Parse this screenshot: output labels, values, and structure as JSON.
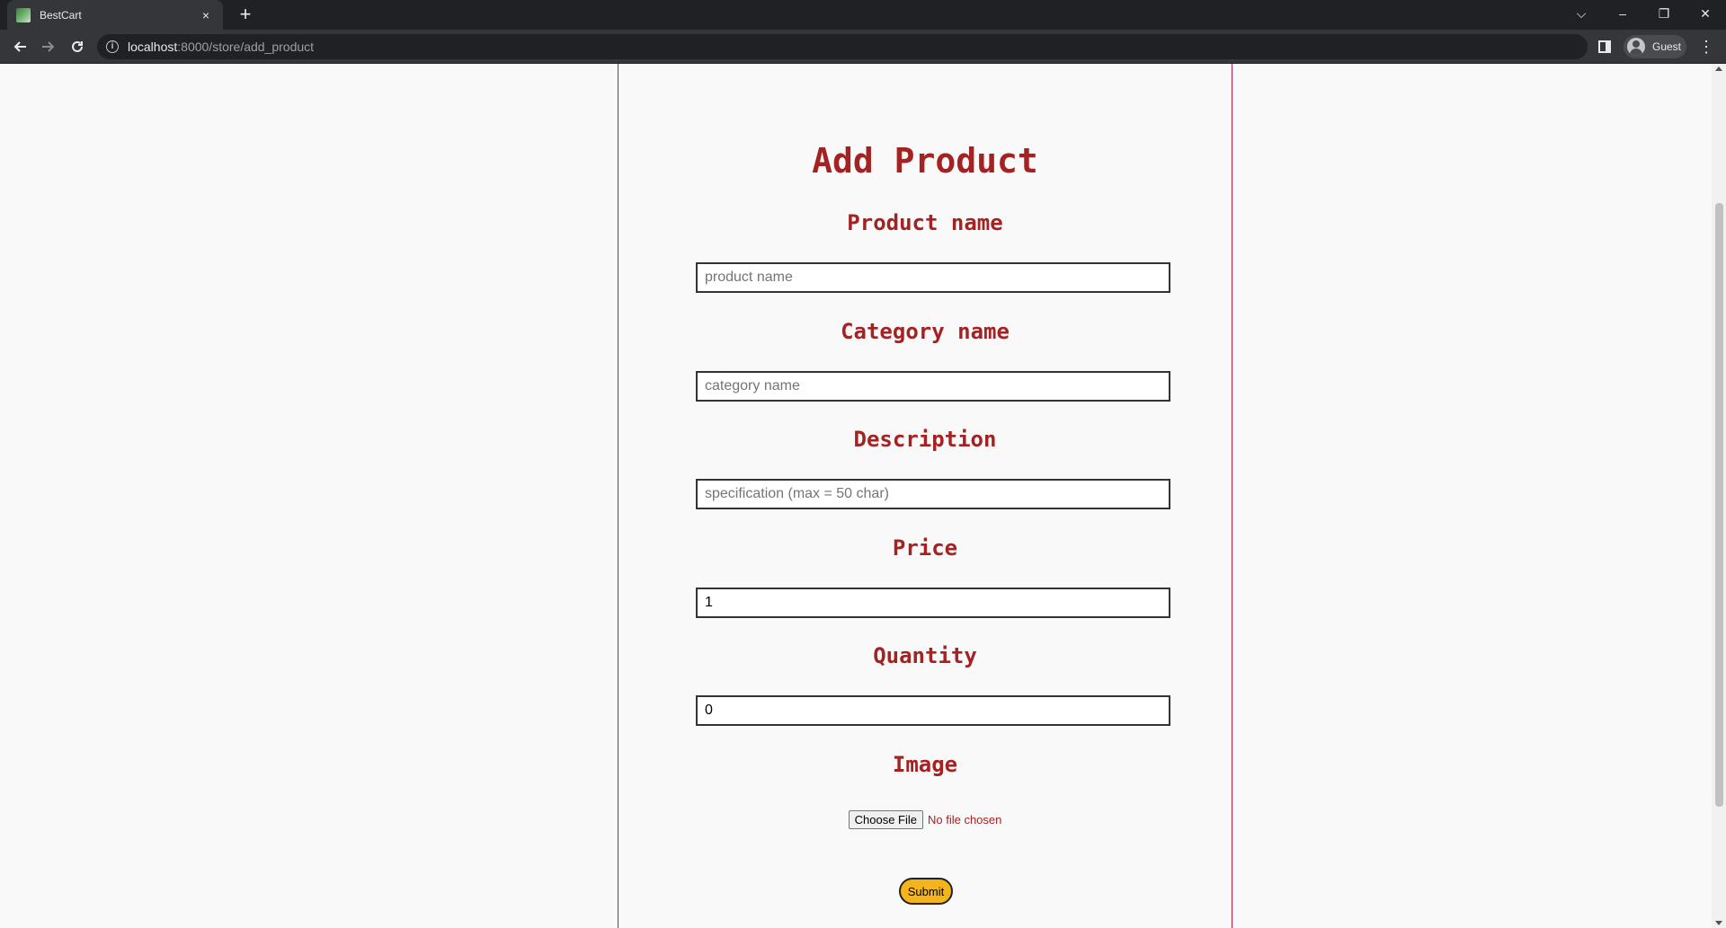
{
  "browser": {
    "tab_title": "BestCart",
    "tab_close": "×",
    "new_tab": "+",
    "url_host": "localhost",
    "url_path": ":8000/store/add_product",
    "profile_label": "Guest",
    "window_controls": {
      "dropdown": "⌵",
      "minimize": "–",
      "restore": "❐",
      "close": "✕"
    }
  },
  "page": {
    "title": "Add Product",
    "fields": {
      "product_name": {
        "label": "Product name",
        "placeholder": "product name",
        "value": ""
      },
      "category_name": {
        "label": "Category name",
        "placeholder": "category name",
        "value": ""
      },
      "description": {
        "label": "Description",
        "placeholder": "specification (max = 50 char)",
        "value": ""
      },
      "price": {
        "label": "Price",
        "placeholder": "",
        "value": "1"
      },
      "quantity": {
        "label": "Quantity",
        "placeholder": "",
        "value": "0"
      },
      "image": {
        "label": "Image",
        "button_label": "Choose File",
        "status": "No file chosen"
      }
    },
    "submit_label": "Submit"
  },
  "colors": {
    "heading": "#a52222",
    "card_border": "#b71c3a",
    "submit_bg": "#f5b41a",
    "page_bg": "#f9f9f9"
  }
}
